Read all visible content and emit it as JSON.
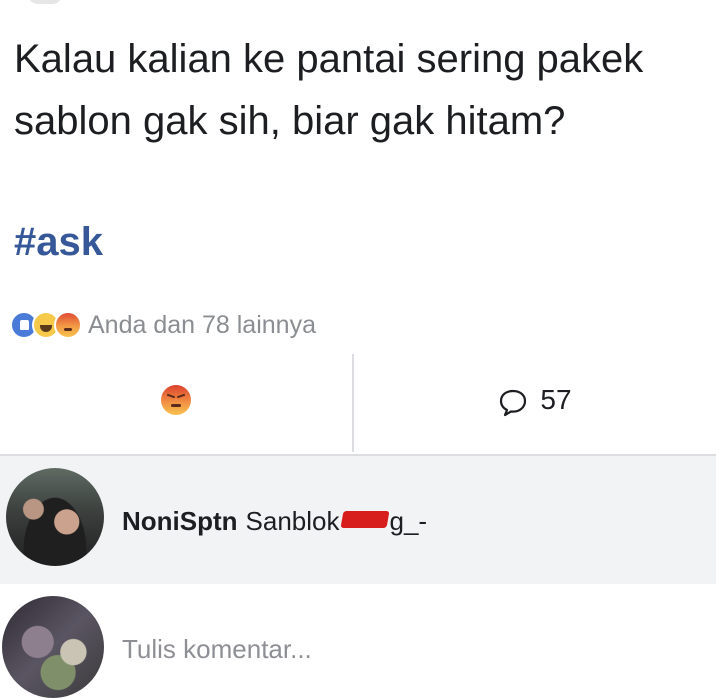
{
  "post": {
    "text": "Kalau kalian ke pantai sering pakek sablon gak sih, biar gak hitam?",
    "hashtag": "#ask"
  },
  "reactions": {
    "icons": [
      "like-icon",
      "haha-icon",
      "angry-icon"
    ],
    "summary": "Anda dan 78 lainnya"
  },
  "actions": {
    "react_icon": "angry-icon",
    "comment_icon": "speech-bubble-icon",
    "comment_count": "57"
  },
  "comments": [
    {
      "author": "NoniSptn",
      "text_before": "Sanblok",
      "text_after": "g_-"
    }
  ],
  "composer": {
    "placeholder": "Tulis komentar..."
  },
  "colors": {
    "hashtag": "#365899",
    "like_blue": "#4a7bd8",
    "angry_red": "#de3f2d",
    "muted_text": "#8a8d91",
    "comment_bg": "#f2f3f5"
  }
}
